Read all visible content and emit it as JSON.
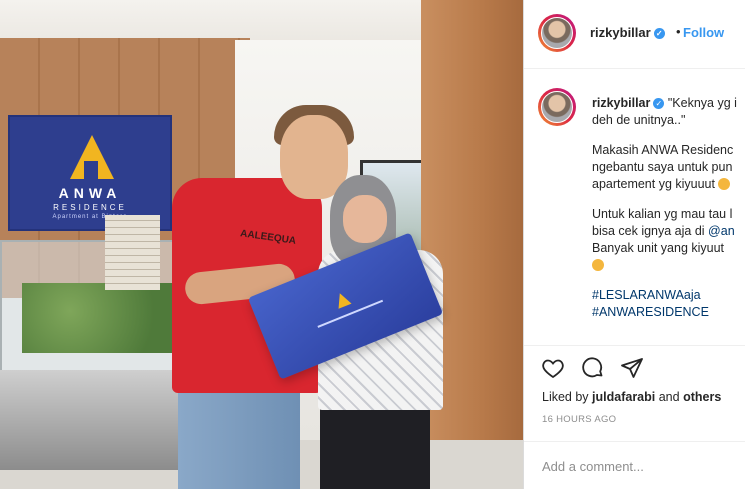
{
  "photo": {
    "logo": {
      "name": "ANWA",
      "sub": "RESIDENCE",
      "tagline": "Apartment at Bintaro"
    },
    "shirt_text": "AALEEQUA",
    "brochure_alt": "ANWA brochure"
  },
  "header": {
    "username": "rizkybillar",
    "separator": "•",
    "follow_label": "Follow"
  },
  "caption": {
    "username": "rizkybillar",
    "line1": "\"Keknya yg i",
    "line2": "deh de unitnya..\"",
    "para2_lines": [
      "Makasih ANWA Residenc",
      "ngebantu saya untuk pun",
      "apartement yg kiyuuut"
    ],
    "para3_lines": [
      "Untuk kalian yg mau tau l",
      "bisa cek ignya aja di ",
      "Banyak unit yang kiyuut"
    ],
    "mention": "@an",
    "hashtags": [
      "#LESLARANWAaja",
      "#ANWARESIDENCE"
    ]
  },
  "actions": {
    "icons": [
      "heart-icon",
      "comment-icon",
      "share-icon"
    ]
  },
  "likes": {
    "prefix": "Liked by ",
    "user": "juldafarabi",
    "middle": " and ",
    "others": "others"
  },
  "timestamp": "16 HOURS AGO",
  "comment": {
    "placeholder": "Add a comment..."
  },
  "colors": {
    "accent": "#3897f0",
    "hashtag": "#00376b",
    "muted": "#8e8e8e",
    "border": "#efefef"
  }
}
